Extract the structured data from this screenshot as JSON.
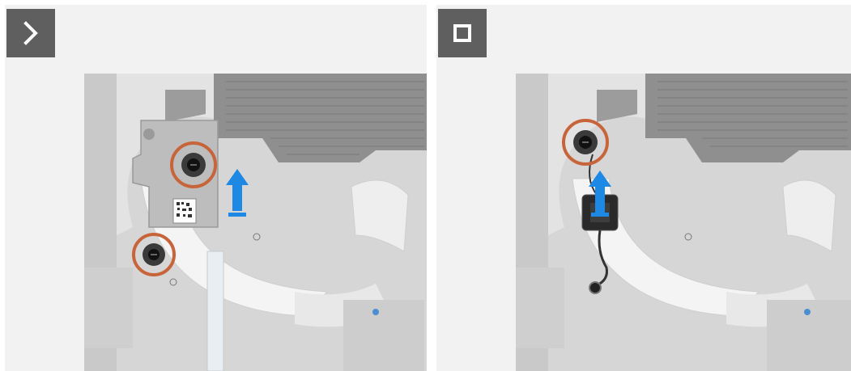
{
  "steps": [
    {
      "badge_icon": "chevron-right-icon",
      "badge_color": "#5f5f5f",
      "callouts": [
        "screw-callout-upper",
        "screw-callout-lower"
      ],
      "arrow_icon": "lift-arrow-icon"
    },
    {
      "badge_icon": "square-stop-icon",
      "badge_color": "#5f5f5f",
      "callouts": [
        "screw-callout"
      ],
      "arrow_icon": "lift-arrow-icon"
    }
  ],
  "colors": {
    "callout_ring": "#c8643a",
    "arrow": "#1e88e5",
    "chassis": "#d9d9d9",
    "vent": "#8e8e8e"
  }
}
